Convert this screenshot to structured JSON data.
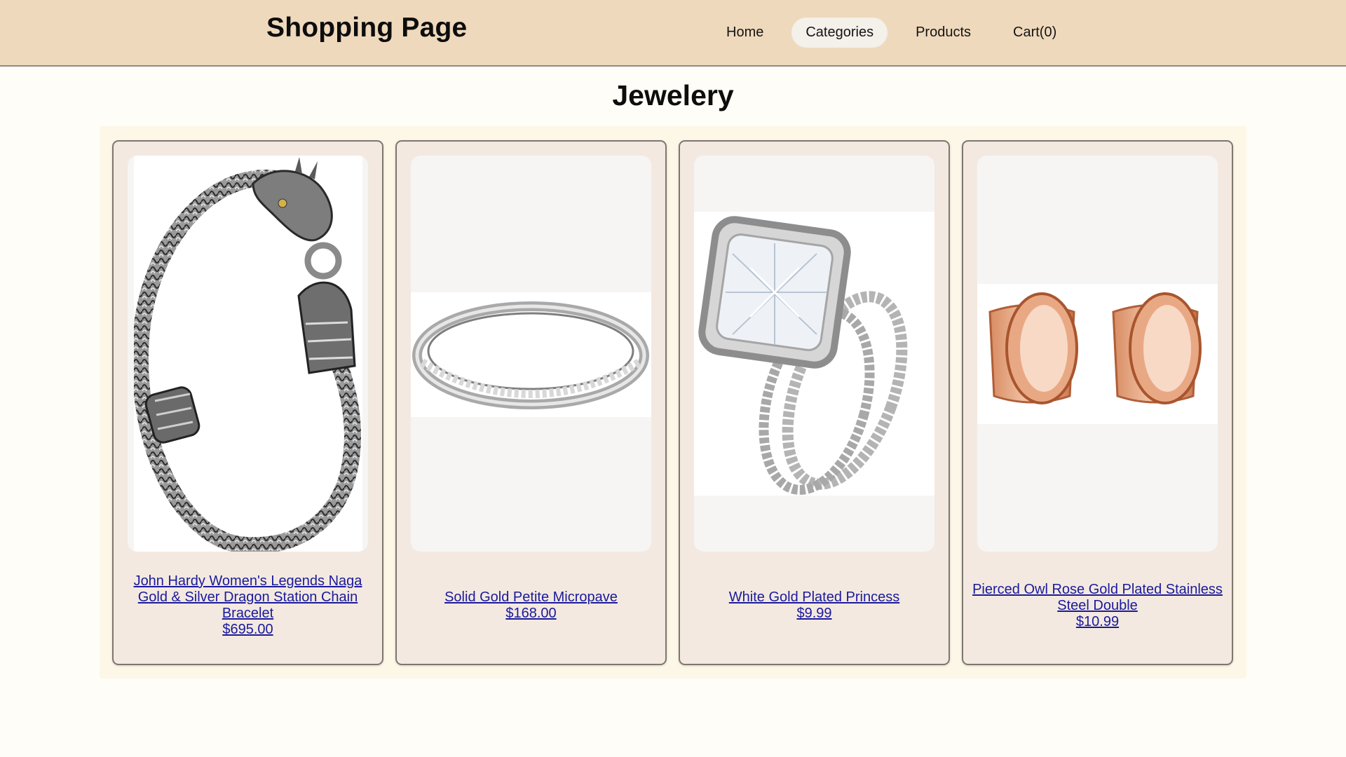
{
  "header": {
    "title": "Shopping Page",
    "nav": [
      {
        "label": "Home"
      },
      {
        "label": "Categories",
        "active": true
      },
      {
        "label": "Products"
      },
      {
        "label": "Cart(0)"
      }
    ]
  },
  "section": {
    "title": "Jewelery"
  },
  "products": [
    {
      "name": "John Hardy Women's Legends Naga Gold & Silver Dragon Station Chain Bracelet",
      "price": "$695.00",
      "image": "dragon-bracelet-image"
    },
    {
      "name": "Solid Gold Petite Micropave",
      "price": "$168.00",
      "image": "silver-band-ring-image"
    },
    {
      "name": "White Gold Plated Princess",
      "price": "$9.99",
      "image": "princess-ring-set-image"
    },
    {
      "name": "Pierced Owl Rose Gold Plated Stainless Steel Double",
      "price": "$10.99",
      "image": "rose-gold-tunnels-image"
    }
  ],
  "colors": {
    "header_bg": "#efd9bc",
    "page_bg": "#fefdf7",
    "card_bg": "#f3e9e1",
    "link": "#1a1a9a",
    "active_nav_bg": "#f4f0ea"
  }
}
